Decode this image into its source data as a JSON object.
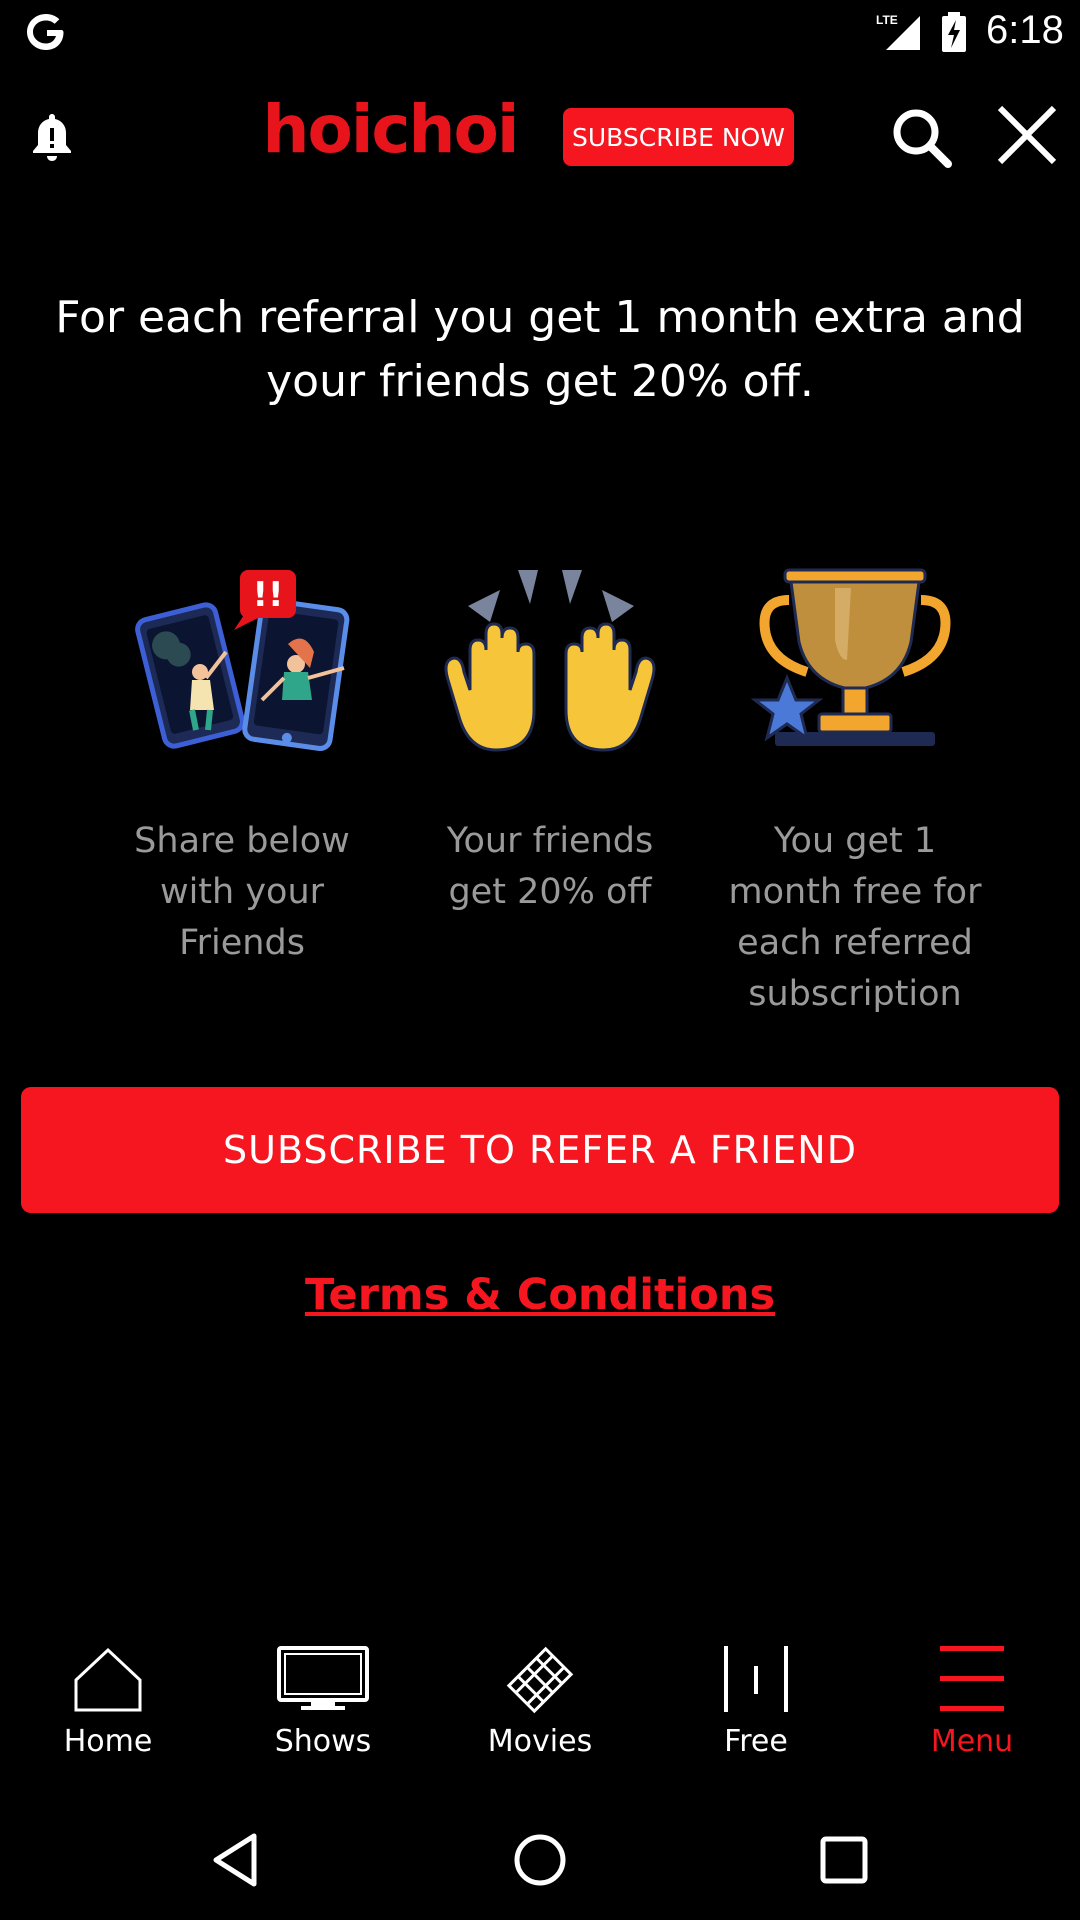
{
  "status_bar": {
    "time": "6:18",
    "network": "LTE"
  },
  "header": {
    "brand": "hoichoi",
    "subscribe_label": "SUBSCRIBE NOW"
  },
  "headline": "For each referral you get 1 month extra and your friends get 20% off.",
  "steps": [
    {
      "icon": "share-phones-illustration",
      "text": "Share below with your Friends"
    },
    {
      "icon": "raised-hands-illustration",
      "text": "Your friends get 20% off"
    },
    {
      "icon": "trophy-illustration",
      "text": "You get 1 month free for each referred subscription"
    }
  ],
  "cta_label": "SUBSCRIBE TO REFER A FRIEND",
  "terms_label": "Terms & Conditions",
  "bottom_nav": [
    {
      "label": "Home",
      "icon": "home-icon",
      "active": false
    },
    {
      "label": "Shows",
      "icon": "tv-icon",
      "active": false
    },
    {
      "label": "Movies",
      "icon": "film-icon",
      "active": false
    },
    {
      "label": "Free",
      "icon": "free-icon",
      "active": false
    },
    {
      "label": "Menu",
      "icon": "menu-icon",
      "active": true
    }
  ],
  "colors": {
    "accent": "#f5161f",
    "background": "#000000",
    "muted_text": "#9a9a9a"
  }
}
